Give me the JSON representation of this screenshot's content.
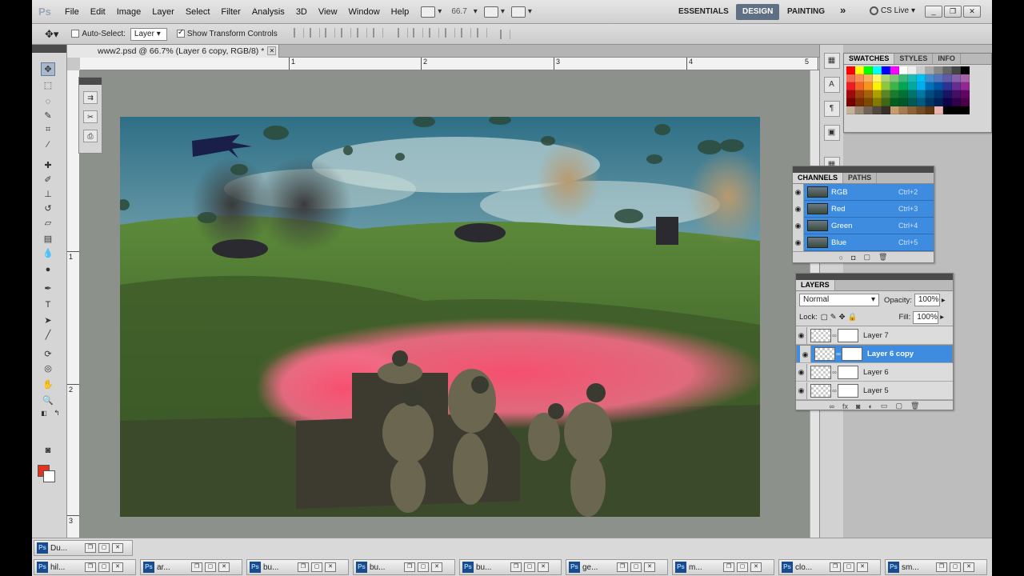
{
  "menubar": {
    "logo": "Ps",
    "items": [
      "File",
      "Edit",
      "Image",
      "Layer",
      "Select",
      "Filter",
      "Analysis",
      "3D",
      "View",
      "Window",
      "Help"
    ],
    "zoom": "66.7",
    "workspaces": [
      "ESSENTIALS",
      "DESIGN",
      "PAINTING"
    ],
    "active_workspace": "DESIGN",
    "more": "»",
    "cs_live": "CS Live"
  },
  "options": {
    "auto_select_label": "Auto-Select:",
    "auto_select_checked": false,
    "auto_select_value": "Layer",
    "show_transform_label": "Show Transform Controls",
    "show_transform_checked": true
  },
  "document": {
    "tab_title": "www2.psd @ 66.7% (Layer 6 copy, RGB/8) *",
    "ruler_top_labels": [
      "1",
      "2",
      "3",
      "4",
      "5"
    ],
    "ruler_left_labels": [
      "1",
      "2",
      "3"
    ]
  },
  "swatches": {
    "tabs": [
      "SWATCHES",
      "STYLES",
      "INFO"
    ],
    "active_tab": "SWATCHES"
  },
  "channels": {
    "tabs": [
      "CHANNELS",
      "PATHS"
    ],
    "active_tab": "CHANNELS",
    "rows": [
      {
        "name": "RGB",
        "shortcut": "Ctrl+2"
      },
      {
        "name": "Red",
        "shortcut": "Ctrl+3"
      },
      {
        "name": "Green",
        "shortcut": "Ctrl+4"
      },
      {
        "name": "Blue",
        "shortcut": "Ctrl+5"
      }
    ]
  },
  "layers": {
    "title": "LAYERS",
    "blend_mode": "Normal",
    "opacity_label": "Opacity:",
    "opacity": "100%",
    "lock_label": "Lock:",
    "fill_label": "Fill:",
    "fill": "100%",
    "rows": [
      {
        "name": "Layer 7",
        "selected": false
      },
      {
        "name": "Layer 6 copy",
        "selected": true
      },
      {
        "name": "Layer 6",
        "selected": false
      },
      {
        "name": "Layer 5",
        "selected": false
      }
    ]
  },
  "taskbar": {
    "row1": [
      {
        "label": "Du..."
      }
    ],
    "row2": [
      {
        "label": "hil..."
      },
      {
        "label": "ar..."
      },
      {
        "label": "bu..."
      },
      {
        "label": "bu..."
      },
      {
        "label": "bu..."
      },
      {
        "label": "ge..."
      },
      {
        "label": "m..."
      },
      {
        "label": "clo..."
      },
      {
        "label": "sm..."
      }
    ]
  },
  "colors": {
    "accent": "#3d8ce0",
    "foreground": "#e0341d",
    "background": "#ffffff",
    "workspace_active": "#5f6f84"
  }
}
